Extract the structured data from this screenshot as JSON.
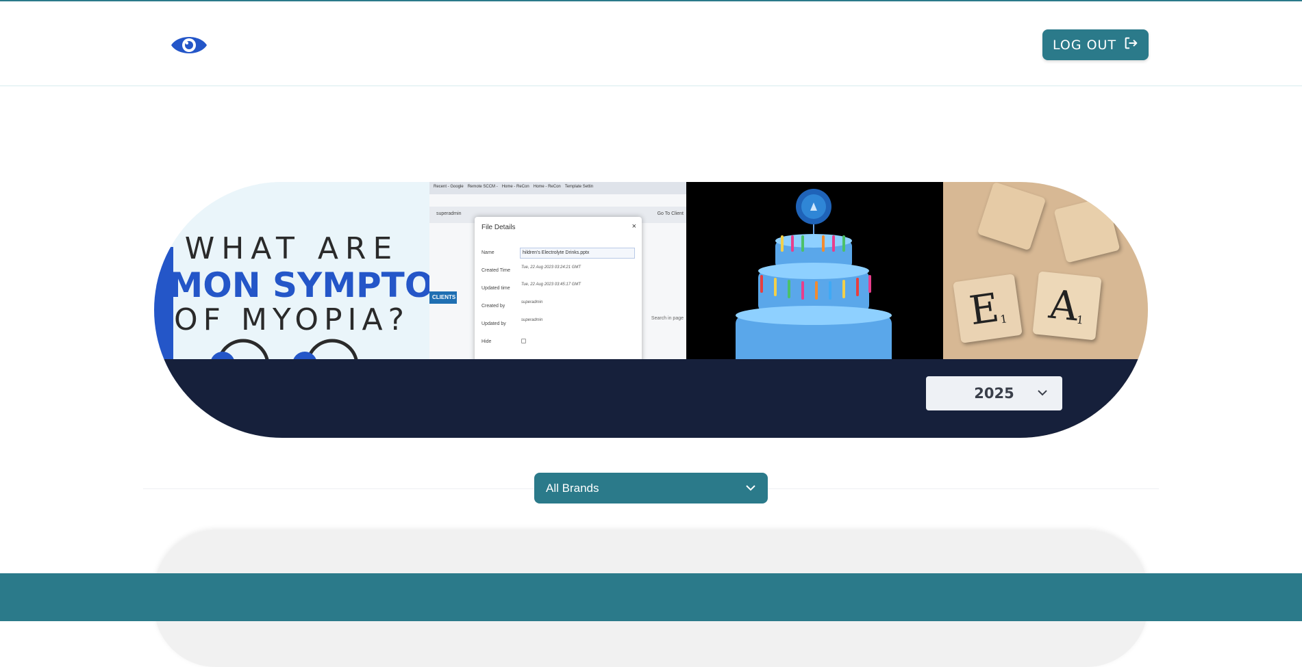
{
  "header": {
    "logo_icon": "eye-icon",
    "logout_label": "LOG OUT",
    "logout_icon": "logout-arrow-icon"
  },
  "banner": {
    "panel1": {
      "line1": "WHAT ARE",
      "line2": "MMON SYMPTO",
      "line3": "OF MYOPIA?"
    },
    "panel2": {
      "tabs": [
        "Recent - Google",
        "Remote SCCM - ",
        "Home - ReCon",
        "Home - ReCon",
        "Template Settin"
      ],
      "modal_title": "File Details",
      "rows": {
        "name_label": "Name",
        "name_value": "hildren's Electrolyte Drinks.pptx",
        "created_time_label": "Created Time",
        "created_time_value": "Tue, 22 Aug 2023 03:24:21 GMT",
        "updated_time_label": "Updated time",
        "updated_time_value": "Tue, 22 Aug 2023 03:45:17 GMT",
        "created_by_label": "Created by",
        "created_by_value": "superadmin",
        "updated_by_label": "Updated by",
        "updated_by_value": "superadmin",
        "hide_label": "Hide"
      },
      "clients_label": "CLIENTS",
      "go_to_client": "Go To Client",
      "search_in_page": "Search in page",
      "user": "superadmin"
    },
    "panel3": {
      "image": "birthday-cake"
    },
    "panel4": {
      "tiles": [
        "E",
        "A"
      ],
      "tile_subscript": "1"
    },
    "year_value": "2025"
  },
  "brand_filter": {
    "value": "All Brands"
  },
  "colors": {
    "teal": "#2b7a8a",
    "navy": "#16203b",
    "blue": "#2456c8"
  }
}
